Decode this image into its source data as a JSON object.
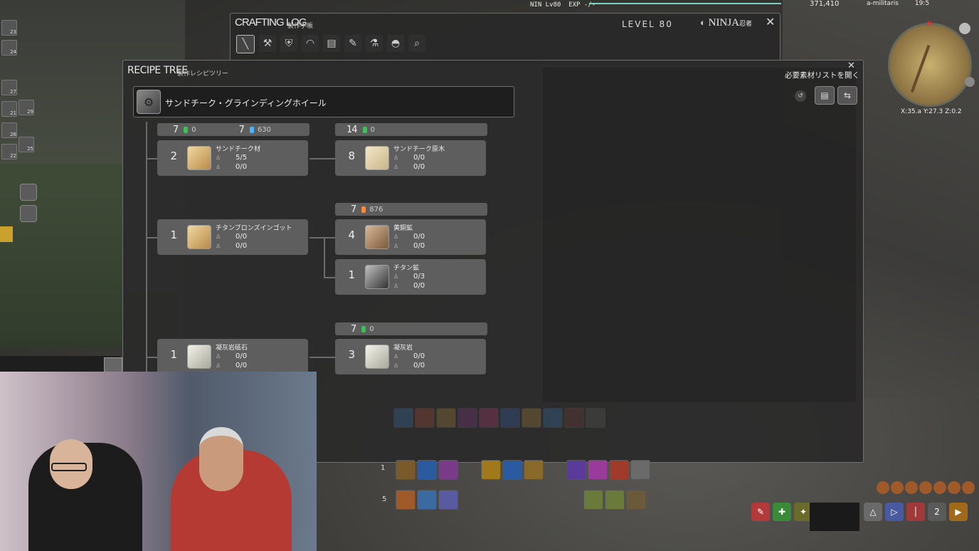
{
  "status": {
    "job_level": "NIN Lv80",
    "exp": "EXP -/-",
    "gil": "371,410",
    "player": "a-militaris",
    "time": "19:5"
  },
  "crafting_log": {
    "title": "CRAFTING LOG",
    "subtitle": "製作手帳",
    "level": "LEVEL 80",
    "job": "NINJA",
    "job_jp": "忍者"
  },
  "recipe_tree": {
    "title": "RECIPE TREE",
    "subtitle": "製作レシピツリー",
    "open_list": "必要素材リストを開く",
    "header_item": "サンドチーク・グラインディングホイール",
    "crystal_bars": [
      {
        "id": "a",
        "q1": "7",
        "c1": "#3fbf5a",
        "v1": "0",
        "q2": "7",
        "c2": "#4ab3ff",
        "v2": "630"
      },
      {
        "id": "b",
        "q1": "14",
        "c1": "#3fbf5a",
        "v1": "0"
      },
      {
        "id": "c",
        "q1": "7",
        "c1": "#ff8a3a",
        "v1": "876"
      },
      {
        "id": "d",
        "q1": "7",
        "c1": "#3fbf5a",
        "v1": "0"
      }
    ],
    "items": [
      {
        "qty": "2",
        "name": "サンドチーク材",
        "r1": "5/5",
        "r2": "0/0",
        "icon": "wood"
      },
      {
        "qty": "8",
        "name": "サンドチーク原木",
        "r1": "0/0",
        "r2": "0/0",
        "icon": "log"
      },
      {
        "qty": "1",
        "name": "チタンブロンズインゴット",
        "r1": "0/0",
        "r2": "0/0",
        "icon": "wood"
      },
      {
        "qty": "4",
        "name": "黄銅鉱",
        "r1": "0/0",
        "r2": "0/0",
        "icon": "ore"
      },
      {
        "qty": "1",
        "name": "チタン鉱",
        "r1": "0/3",
        "r2": "0/0",
        "icon": "ore2"
      },
      {
        "qty": "1",
        "name": "凝灰岩砥石",
        "r1": "0/0",
        "r2": "0/0",
        "icon": "stone"
      },
      {
        "qty": "3",
        "name": "凝灰岩",
        "r1": "0/0",
        "r2": "0/0",
        "icon": "stone"
      }
    ]
  },
  "minimap": {
    "coords": "X:35.a Y:27.3 Z:0.2"
  },
  "hotbars": {
    "row1_num": "1",
    "row5_num": "5"
  },
  "icons": [
    "close-icon",
    "pencil-icon",
    "magnifier-icon",
    "gear-icon"
  ]
}
